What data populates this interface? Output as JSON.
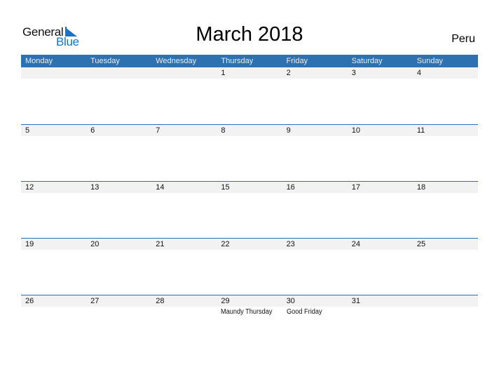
{
  "logo": {
    "word1": "General",
    "word2": "Blue"
  },
  "title": "March 2018",
  "country": "Peru",
  "colors": {
    "accent": "#2e71b1",
    "strip": "#f2f2f2",
    "logo_blue": "#1a72c4"
  },
  "weekdays": [
    "Monday",
    "Tuesday",
    "Wednesday",
    "Thursday",
    "Friday",
    "Saturday",
    "Sunday"
  ],
  "weeks": [
    [
      "",
      "",
      "",
      "1",
      "2",
      "3",
      "4"
    ],
    [
      "5",
      "6",
      "7",
      "8",
      "9",
      "10",
      "11"
    ],
    [
      "12",
      "13",
      "14",
      "15",
      "16",
      "17",
      "18"
    ],
    [
      "19",
      "20",
      "21",
      "22",
      "23",
      "24",
      "25"
    ],
    [
      "26",
      "27",
      "28",
      "29",
      "30",
      "31",
      ""
    ]
  ],
  "events": {
    "29": "Maundy Thursday",
    "30": "Good Friday"
  }
}
